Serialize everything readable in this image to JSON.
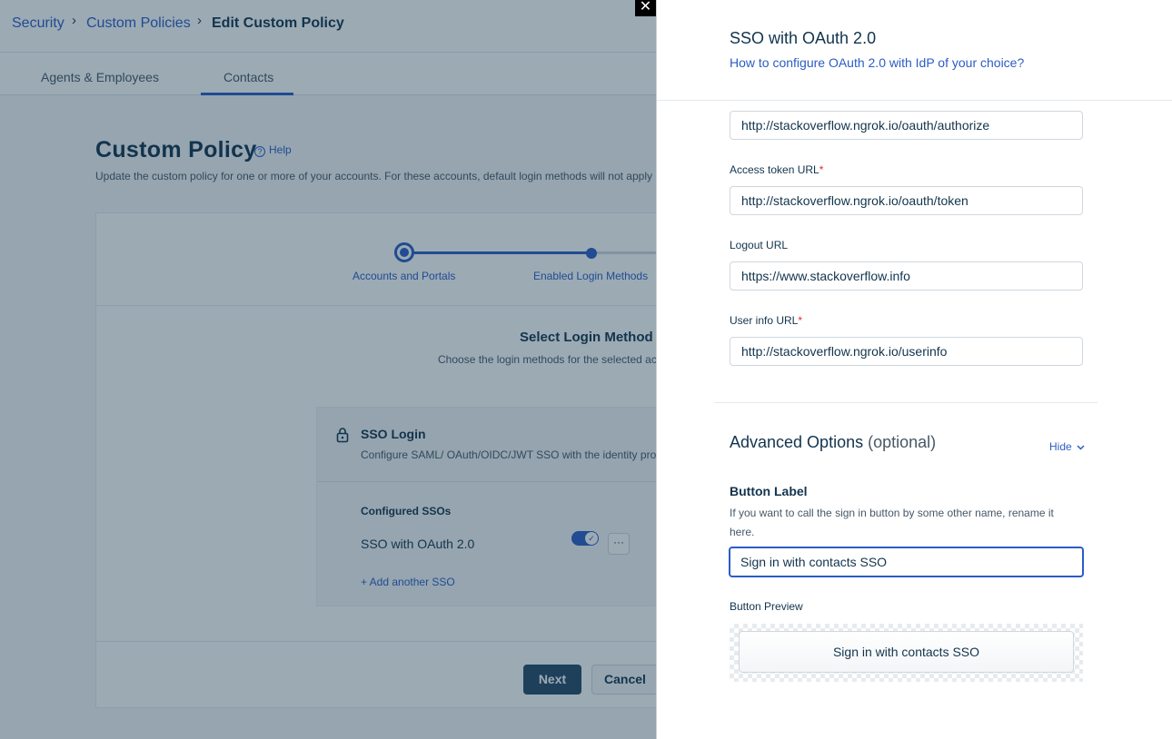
{
  "breadcrumb": {
    "items": [
      "Security",
      "Custom Policies"
    ],
    "current": "Edit Custom Policy"
  },
  "tabs": [
    {
      "label": "Agents & Employees",
      "active": false
    },
    {
      "label": "Contacts",
      "active": true
    }
  ],
  "page": {
    "title": "Custom Policy",
    "help_label": "Help",
    "subtitle": "Update the custom policy for one or more of your accounts. For these accounts, default login methods will not apply"
  },
  "stepper": {
    "steps": [
      "Accounts and Portals",
      "Enabled Login Methods"
    ]
  },
  "login_methods": {
    "title": "Select Login Method",
    "subtitle": "Choose the login methods for the selected ac",
    "sso": {
      "title": "SSO Login",
      "description": "Configure SAML/ OAuth/OIDC/JWT SSO with the identity prov",
      "configured_label": "Configured SSOs",
      "items": [
        {
          "name": "SSO with OAuth 2.0",
          "enabled": true
        }
      ],
      "add_label": "+ Add another SSO"
    }
  },
  "footer": {
    "next_label": "Next",
    "cancel_label": "Cancel"
  },
  "drawer": {
    "close_label": "✕",
    "title": "SSO with OAuth 2.0",
    "config_link": "How to configure OAuth 2.0 with IdP of your choice?",
    "authorize_url": "http://stackoverflow.ngrok.io/oauth/authorize",
    "access_token": {
      "label": "Access token URL",
      "required": "*",
      "value": "http://stackoverflow.ngrok.io/oauth/token"
    },
    "logout": {
      "label": "Logout URL",
      "value": "https://www.stackoverflow.info"
    },
    "user_info": {
      "label": "User info URL",
      "required": "*",
      "value": "http://stackoverflow.ngrok.io/userinfo"
    },
    "advanced": {
      "title": "Advanced Options",
      "optional": "(optional)",
      "hide_label": "Hide"
    },
    "button_label": {
      "title": "Button Label",
      "help": "If you want to call the sign in button by some other name, rename it here.",
      "value": "Sign in with contacts SSO"
    },
    "preview": {
      "label": "Button Preview",
      "button_text": "Sign in with contacts SSO"
    }
  },
  "colors": {
    "accent": "#2c5cc5",
    "primary_button": "#264966",
    "text": "#12344d",
    "required": "#d72d30"
  }
}
